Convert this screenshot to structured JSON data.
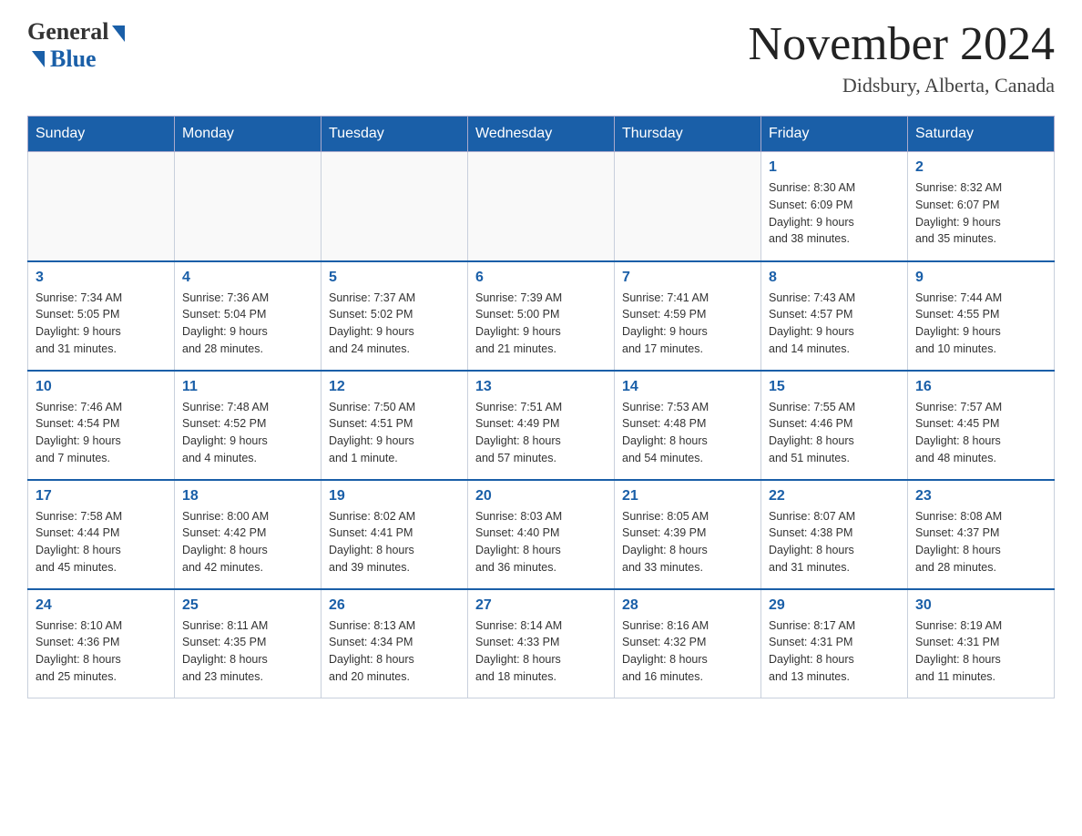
{
  "header": {
    "logo_general": "General",
    "logo_blue": "Blue",
    "month_title": "November 2024",
    "location": "Didsbury, Alberta, Canada"
  },
  "weekdays": [
    "Sunday",
    "Monday",
    "Tuesday",
    "Wednesday",
    "Thursday",
    "Friday",
    "Saturday"
  ],
  "weeks": [
    [
      {
        "day": "",
        "info": ""
      },
      {
        "day": "",
        "info": ""
      },
      {
        "day": "",
        "info": ""
      },
      {
        "day": "",
        "info": ""
      },
      {
        "day": "",
        "info": ""
      },
      {
        "day": "1",
        "info": "Sunrise: 8:30 AM\nSunset: 6:09 PM\nDaylight: 9 hours\nand 38 minutes."
      },
      {
        "day": "2",
        "info": "Sunrise: 8:32 AM\nSunset: 6:07 PM\nDaylight: 9 hours\nand 35 minutes."
      }
    ],
    [
      {
        "day": "3",
        "info": "Sunrise: 7:34 AM\nSunset: 5:05 PM\nDaylight: 9 hours\nand 31 minutes."
      },
      {
        "day": "4",
        "info": "Sunrise: 7:36 AM\nSunset: 5:04 PM\nDaylight: 9 hours\nand 28 minutes."
      },
      {
        "day": "5",
        "info": "Sunrise: 7:37 AM\nSunset: 5:02 PM\nDaylight: 9 hours\nand 24 minutes."
      },
      {
        "day": "6",
        "info": "Sunrise: 7:39 AM\nSunset: 5:00 PM\nDaylight: 9 hours\nand 21 minutes."
      },
      {
        "day": "7",
        "info": "Sunrise: 7:41 AM\nSunset: 4:59 PM\nDaylight: 9 hours\nand 17 minutes."
      },
      {
        "day": "8",
        "info": "Sunrise: 7:43 AM\nSunset: 4:57 PM\nDaylight: 9 hours\nand 14 minutes."
      },
      {
        "day": "9",
        "info": "Sunrise: 7:44 AM\nSunset: 4:55 PM\nDaylight: 9 hours\nand 10 minutes."
      }
    ],
    [
      {
        "day": "10",
        "info": "Sunrise: 7:46 AM\nSunset: 4:54 PM\nDaylight: 9 hours\nand 7 minutes."
      },
      {
        "day": "11",
        "info": "Sunrise: 7:48 AM\nSunset: 4:52 PM\nDaylight: 9 hours\nand 4 minutes."
      },
      {
        "day": "12",
        "info": "Sunrise: 7:50 AM\nSunset: 4:51 PM\nDaylight: 9 hours\nand 1 minute."
      },
      {
        "day": "13",
        "info": "Sunrise: 7:51 AM\nSunset: 4:49 PM\nDaylight: 8 hours\nand 57 minutes."
      },
      {
        "day": "14",
        "info": "Sunrise: 7:53 AM\nSunset: 4:48 PM\nDaylight: 8 hours\nand 54 minutes."
      },
      {
        "day": "15",
        "info": "Sunrise: 7:55 AM\nSunset: 4:46 PM\nDaylight: 8 hours\nand 51 minutes."
      },
      {
        "day": "16",
        "info": "Sunrise: 7:57 AM\nSunset: 4:45 PM\nDaylight: 8 hours\nand 48 minutes."
      }
    ],
    [
      {
        "day": "17",
        "info": "Sunrise: 7:58 AM\nSunset: 4:44 PM\nDaylight: 8 hours\nand 45 minutes."
      },
      {
        "day": "18",
        "info": "Sunrise: 8:00 AM\nSunset: 4:42 PM\nDaylight: 8 hours\nand 42 minutes."
      },
      {
        "day": "19",
        "info": "Sunrise: 8:02 AM\nSunset: 4:41 PM\nDaylight: 8 hours\nand 39 minutes."
      },
      {
        "day": "20",
        "info": "Sunrise: 8:03 AM\nSunset: 4:40 PM\nDaylight: 8 hours\nand 36 minutes."
      },
      {
        "day": "21",
        "info": "Sunrise: 8:05 AM\nSunset: 4:39 PM\nDaylight: 8 hours\nand 33 minutes."
      },
      {
        "day": "22",
        "info": "Sunrise: 8:07 AM\nSunset: 4:38 PM\nDaylight: 8 hours\nand 31 minutes."
      },
      {
        "day": "23",
        "info": "Sunrise: 8:08 AM\nSunset: 4:37 PM\nDaylight: 8 hours\nand 28 minutes."
      }
    ],
    [
      {
        "day": "24",
        "info": "Sunrise: 8:10 AM\nSunset: 4:36 PM\nDaylight: 8 hours\nand 25 minutes."
      },
      {
        "day": "25",
        "info": "Sunrise: 8:11 AM\nSunset: 4:35 PM\nDaylight: 8 hours\nand 23 minutes."
      },
      {
        "day": "26",
        "info": "Sunrise: 8:13 AM\nSunset: 4:34 PM\nDaylight: 8 hours\nand 20 minutes."
      },
      {
        "day": "27",
        "info": "Sunrise: 8:14 AM\nSunset: 4:33 PM\nDaylight: 8 hours\nand 18 minutes."
      },
      {
        "day": "28",
        "info": "Sunrise: 8:16 AM\nSunset: 4:32 PM\nDaylight: 8 hours\nand 16 minutes."
      },
      {
        "day": "29",
        "info": "Sunrise: 8:17 AM\nSunset: 4:31 PM\nDaylight: 8 hours\nand 13 minutes."
      },
      {
        "day": "30",
        "info": "Sunrise: 8:19 AM\nSunset: 4:31 PM\nDaylight: 8 hours\nand 11 minutes."
      }
    ]
  ]
}
